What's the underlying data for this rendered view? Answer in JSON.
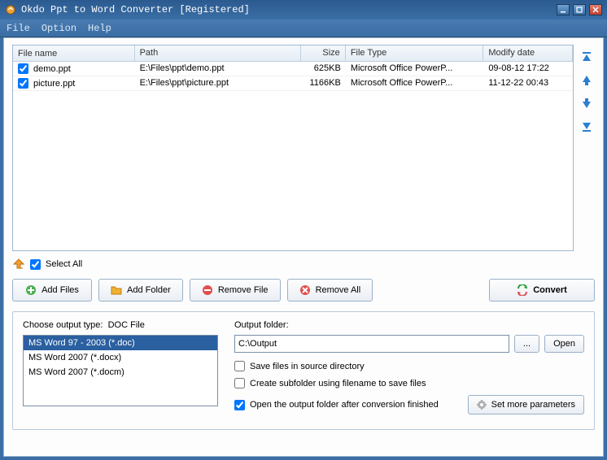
{
  "window": {
    "title": "Okdo Ppt to Word Converter [Registered]"
  },
  "menu": {
    "file": "File",
    "option": "Option",
    "help": "Help"
  },
  "table": {
    "headers": {
      "name": "File name",
      "path": "Path",
      "size": "Size",
      "type": "File Type",
      "date": "Modify date"
    },
    "rows": [
      {
        "checked": true,
        "name": "demo.ppt",
        "path": "E:\\Files\\ppt\\demo.ppt",
        "size": "625KB",
        "type": "Microsoft Office PowerP...",
        "date": "09-08-12 17:22"
      },
      {
        "checked": true,
        "name": "picture.ppt",
        "path": "E:\\Files\\ppt\\picture.ppt",
        "size": "1166KB",
        "type": "Microsoft Office PowerP...",
        "date": "11-12-22 00:43"
      }
    ]
  },
  "selectall": {
    "label": "Select All",
    "checked": true
  },
  "toolbar": {
    "addfiles": "Add Files",
    "addfolder": "Add Folder",
    "removefile": "Remove File",
    "removeall": "Remove All",
    "convert": "Convert"
  },
  "output": {
    "choose_label": "Choose output type:",
    "doc_file": "DOC File",
    "types": [
      "MS Word 97 - 2003 (*.doc)",
      "MS Word 2007 (*.docx)",
      "MS Word 2007 (*.docm)"
    ],
    "selected_index": 0,
    "folder_label": "Output folder:",
    "folder_value": "C:\\Output",
    "browse": "...",
    "open": "Open",
    "save_source": "Save files in source directory",
    "create_sub": "Create subfolder using filename to save files",
    "open_after": "Open the output folder after conversion finished",
    "open_after_checked": true,
    "set_more": "Set more parameters"
  }
}
